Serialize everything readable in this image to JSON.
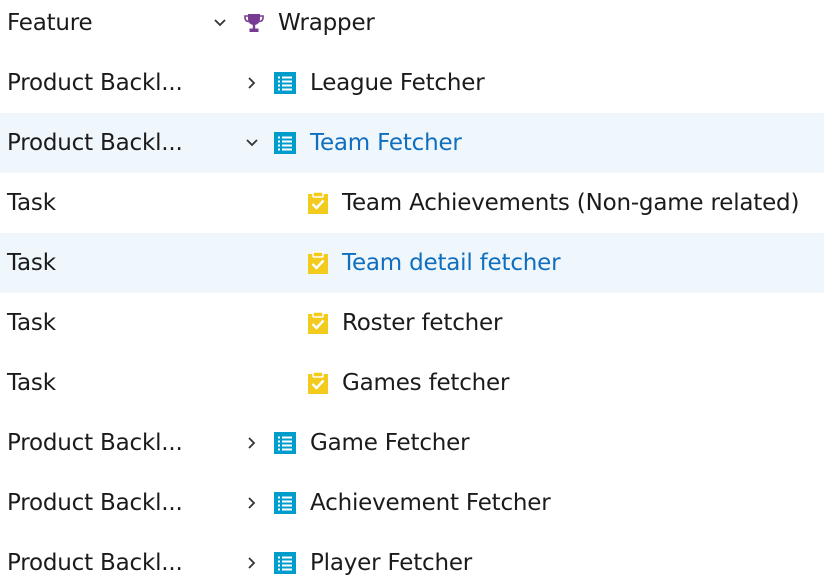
{
  "colors": {
    "highlight_row": "#eff6fc",
    "link_title": "#106ebe",
    "feature_icon": "#773b93",
    "backlog_icon": "#009ccc",
    "task_icon": "#f2cb1d"
  },
  "rows": [
    {
      "type": "Feature",
      "title": "Wrapper",
      "icon": "trophy-icon",
      "chevron": "chevron-down-icon"
    },
    {
      "type": "Product Backl...",
      "title": "League Fetcher",
      "icon": "backlog-item-icon",
      "chevron": "chevron-right-icon"
    },
    {
      "type": "Product Backl...",
      "title": "Team Fetcher",
      "icon": "backlog-item-icon",
      "chevron": "chevron-down-icon",
      "selected": true
    },
    {
      "type": "Task",
      "title": "Team Achievements (Non-game related)",
      "icon": "task-clipboard-icon"
    },
    {
      "type": "Task",
      "title": "Team detail fetcher",
      "icon": "task-clipboard-icon",
      "hovered": true
    },
    {
      "type": "Task",
      "title": "Roster fetcher",
      "icon": "task-clipboard-icon"
    },
    {
      "type": "Task",
      "title": "Games fetcher",
      "icon": "task-clipboard-icon"
    },
    {
      "type": "Product Backl...",
      "title": "Game Fetcher",
      "icon": "backlog-item-icon",
      "chevron": "chevron-right-icon"
    },
    {
      "type": "Product Backl...",
      "title": "Achievement Fetcher",
      "icon": "backlog-item-icon",
      "chevron": "chevron-right-icon"
    },
    {
      "type": "Product Backl...",
      "title": "Player Fetcher",
      "icon": "backlog-item-icon",
      "chevron": "chevron-right-icon"
    }
  ]
}
